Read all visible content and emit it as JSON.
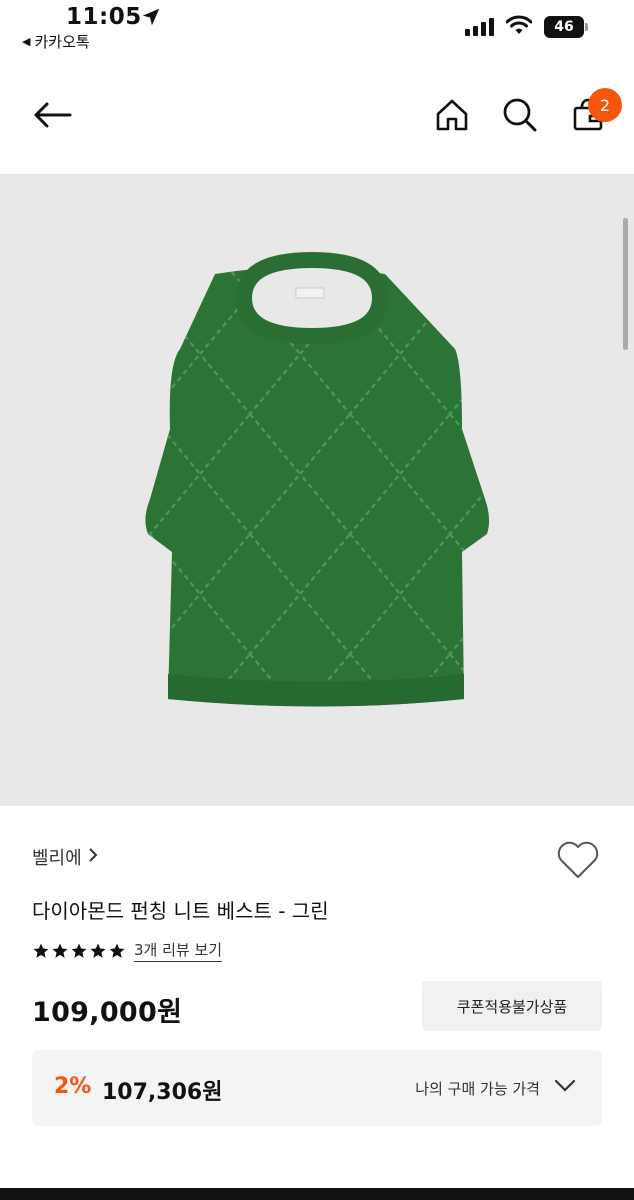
{
  "status_bar": {
    "time": "11:05",
    "back_app": "카카오톡",
    "battery": "46"
  },
  "header": {
    "cart_count": "2"
  },
  "product": {
    "brand": "벨리에",
    "name": "다이아몬드 펀칭 니트 베스트 - 그린",
    "rating_stars": 5,
    "review_link": "3개 리뷰 보기",
    "price": "109,000원",
    "coupon_notice": "쿠폰적용불가상품",
    "discount_rate": "2%",
    "my_price": "107,306원",
    "my_price_label": "나의 구매 가능 가격"
  },
  "colors": {
    "accent": "#f5560f",
    "knit_green": "#2f7a3a",
    "image_bg": "#e8e8e8"
  },
  "icons": [
    "back-arrow-icon",
    "home-icon",
    "search-icon",
    "cart-icon",
    "heart-icon",
    "star-icon",
    "chevron-down-icon",
    "chevron-right-icon",
    "location-arrow-icon",
    "wifi-icon"
  ]
}
